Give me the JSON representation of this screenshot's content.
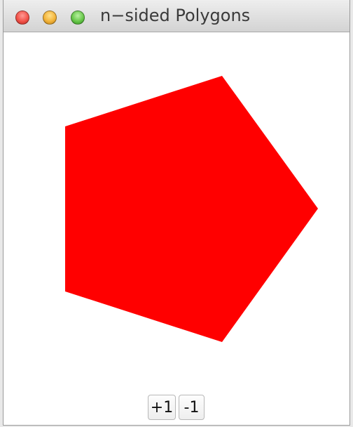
{
  "window": {
    "title": "n−sided Polygons"
  },
  "polygon": {
    "sides": 5,
    "color": "#ff0000"
  },
  "controls": {
    "increment_label": "+1",
    "decrement_label": "-1"
  }
}
